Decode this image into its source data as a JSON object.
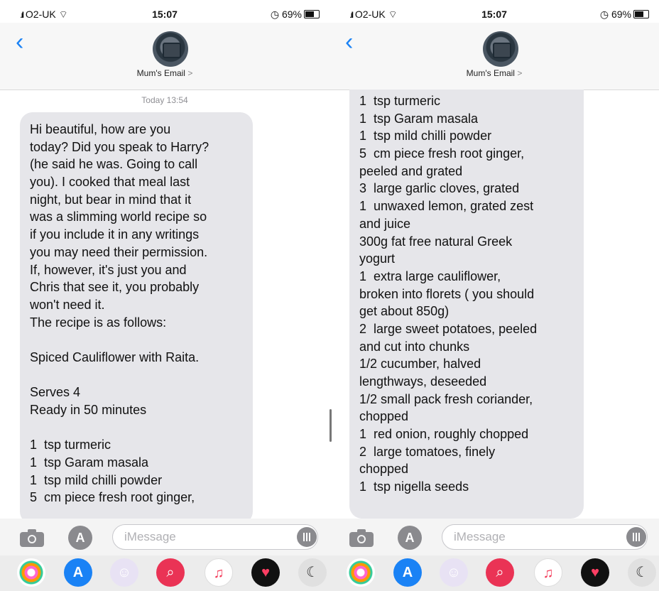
{
  "status": {
    "carrier": "O2-UK",
    "time": "15:07",
    "battery": "69%"
  },
  "contact": {
    "name": "Mum's Email",
    "chevron": ">"
  },
  "thread": {
    "timestamp": "Today 13:54"
  },
  "left_bubble": {
    "lines": [
      "Hi beautiful, how are you",
      "today? Did you speak to Harry?",
      "(he said he was. Going to call",
      "you). I cooked that meal last",
      "night, but bear in mind that it",
      "was a slimming world recipe so",
      "if you include it in any writings",
      "you may need their permission.",
      "If, however, it's just you and",
      "Chris that see it, you probably",
      "won't need it.",
      "The recipe is as follows:",
      "",
      "Spiced Cauliflower with Raita.",
      "",
      "Serves 4",
      "Ready in 50 minutes",
      "",
      "1  tsp turmeric",
      "1  tsp Garam masala",
      "1  tsp mild chilli powder",
      "5  cm piece fresh root ginger,"
    ]
  },
  "right_bubble": {
    "lines": [
      "1  tsp turmeric",
      "1  tsp Garam masala",
      "1  tsp mild chilli powder",
      "5  cm piece fresh root ginger,",
      "peeled and grated",
      "3  large garlic cloves, grated",
      "1  unwaxed lemon, grated zest",
      "and juice",
      "300g fat free natural Greek",
      "yogurt",
      "1  extra large cauliflower,",
      "broken into florets ( you should",
      "get about 850g)",
      "2  large sweet potatoes, peeled",
      "and cut into chunks",
      "1/2 cucumber, halved",
      "lengthways, deseeded",
      "1/2 small pack fresh coriander,",
      "chopped",
      "1  red onion, roughly chopped",
      "2  large tomatoes, finely",
      "chopped",
      "1  tsp nigella seeds"
    ]
  },
  "compose": {
    "placeholder": "iMessage",
    "appstore_glyph": "A"
  },
  "icons": {
    "back": "chevron-left-icon",
    "camera": "camera-icon",
    "appstore": "appstore-icon",
    "audio": "audio-waveform-icon",
    "dock": [
      "photos-app-icon",
      "appstore-app-icon",
      "memoji-app-icon",
      "image-search-app-icon",
      "music-app-icon",
      "digital-touch-app-icon",
      "moon-app-icon"
    ]
  },
  "colors": {
    "accent": "#1a82f5",
    "bubble": "#e6e6ea",
    "header": "#f7f7f7"
  }
}
